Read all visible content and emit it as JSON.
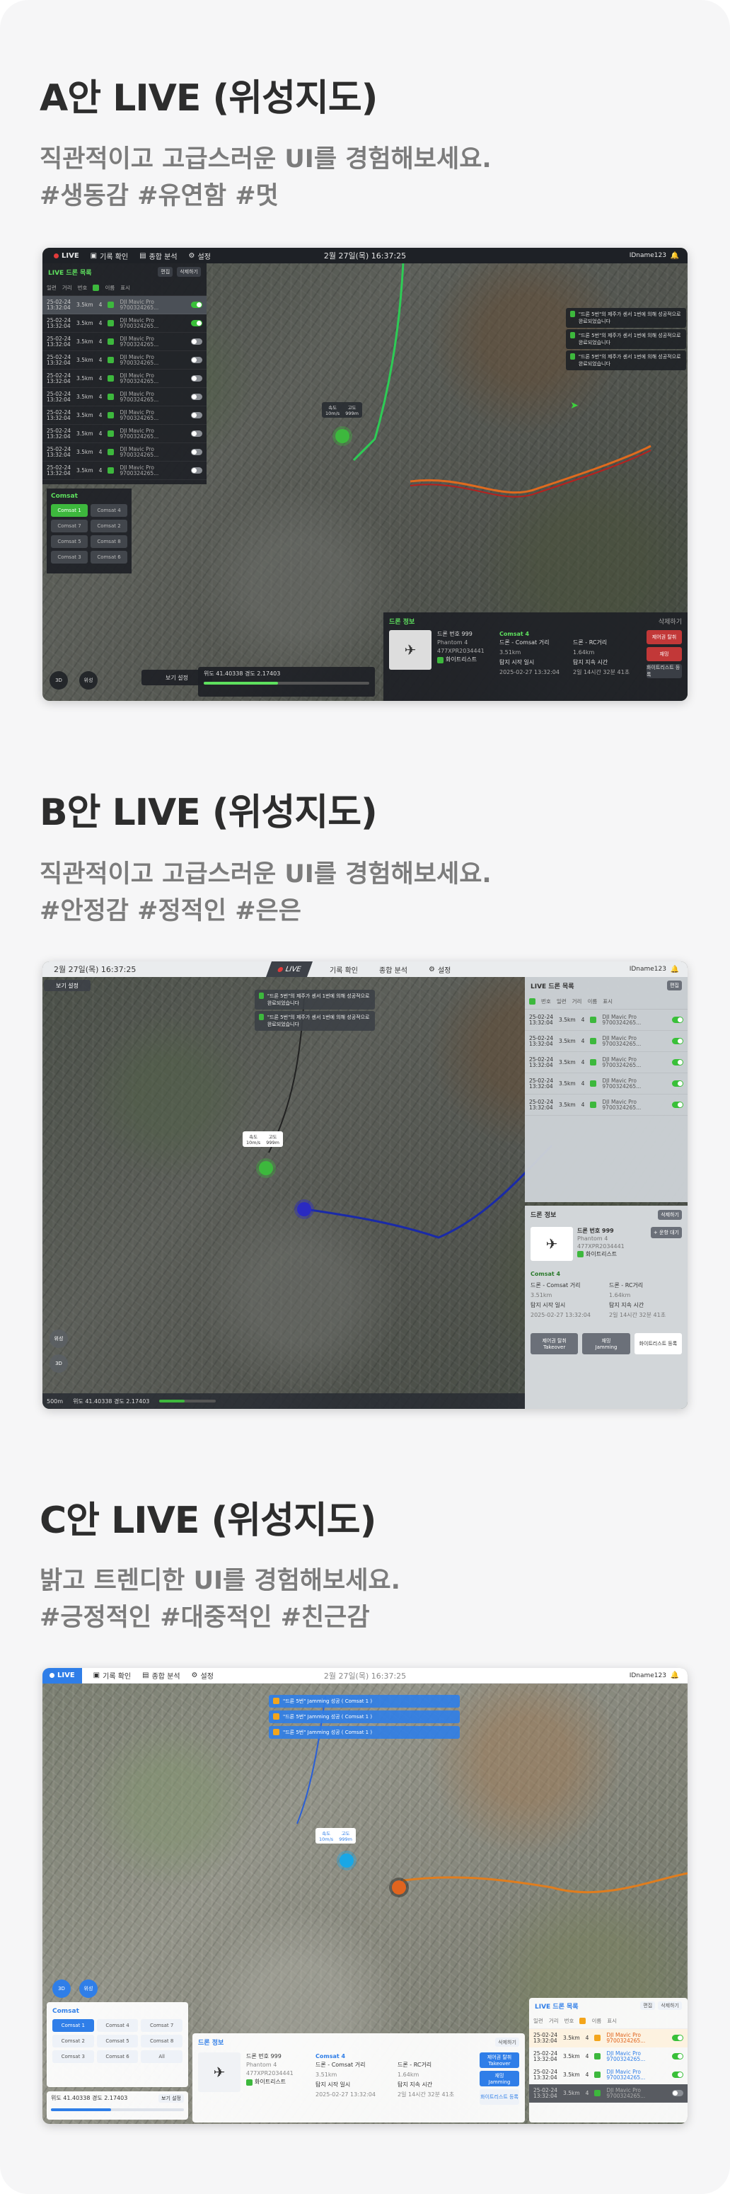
{
  "sections": [
    {
      "title": "A안  LIVE (위성지도)",
      "desc_line1": "직관적이고 고급스러운 UI를 경험해보세요.",
      "desc_line2": "#생동감 #유연함 #멋"
    },
    {
      "title": "B안  LIVE (위성지도)",
      "desc_line1": "직관적이고 고급스러운 UI를 경험해보세요.",
      "desc_line2": "#안정감 #정적인 #은은"
    },
    {
      "title": "C안  LIVE (위성지도)",
      "desc_line1": "밝고 트렌디한 UI를 경험해보세요.",
      "desc_line2": "#긍정적인 #대중적인 #친근감"
    }
  ],
  "app": {
    "live": "LIVE",
    "menu": [
      "기록 확인",
      "종합 분석",
      "설정"
    ],
    "datetime": "2월 27일(목)  16:37:25",
    "user": "IDname123",
    "list_title": "LIVE 드론 목록",
    "list_headers": [
      "일련",
      "거리",
      "번호",
      "이름",
      "표시"
    ],
    "rows": [
      {
        "date": "25-02-24",
        "time": "13:32:04",
        "dist": "3.5km",
        "num": "4",
        "name": "DJI Mavic Pro",
        "serial": "9700324265..."
      }
    ],
    "info_title": "드론 정보",
    "drone_no": "드론 번호 999",
    "drone_model": "Phantom 4",
    "drone_serial": "477XPR2034441",
    "drone_tag": "화이트리스트",
    "sensor": "Comsat 4",
    "dist_label": "드론 - Comsat 거리",
    "dist_val": "3.51km",
    "rc_label": "드론 - RC거리",
    "rc_val": "1.64km",
    "detect_label": "탐지 시작 일시",
    "detect_val": "2025-02-27 13:32:04",
    "keep_label": "탐지 지속 시간",
    "keep_val": "2일 14시간 32분 41초",
    "btn_takeover": "제어권 탈취",
    "btn_takeover_sub": "Takeover",
    "btn_jamming": "재밍",
    "btn_jamming_sub": "Jamming",
    "btn_white": "화이트리스트 등록",
    "notif": "\"드론 5번\"의 제주가 센서 1번에 의해 성공적으로 완료되었습니다",
    "notif_c": "\"드론 5번\" Jamming 성공 ( Comsat 1 )",
    "speed": "속도 10m/s",
    "alt": "고도 999m",
    "speed_label": "속도",
    "speed_val": "10m/s",
    "alt_label": "고도",
    "alt_val": "999m",
    "coords": "위도 41.40338  경도 2.17403",
    "view_setting": "보기 설정",
    "comsat": "Comsat",
    "comsat_items": [
      "Comsat 1",
      "Comsat 4",
      "Comsat 7",
      "Comsat 2",
      "Comsat 5",
      "Comsat 8",
      "Comsat 3",
      "Comsat 6",
      "All"
    ],
    "scale": "500m",
    "btn_3d": "3D",
    "btn_search": "위성",
    "edit": "편집",
    "del": "삭제하기",
    "add_white": "+ 운항 대기"
  },
  "colors": {
    "green": "#3db83d",
    "red": "#d94040",
    "blue": "#2f7ee8",
    "dark": "#1e2126"
  }
}
